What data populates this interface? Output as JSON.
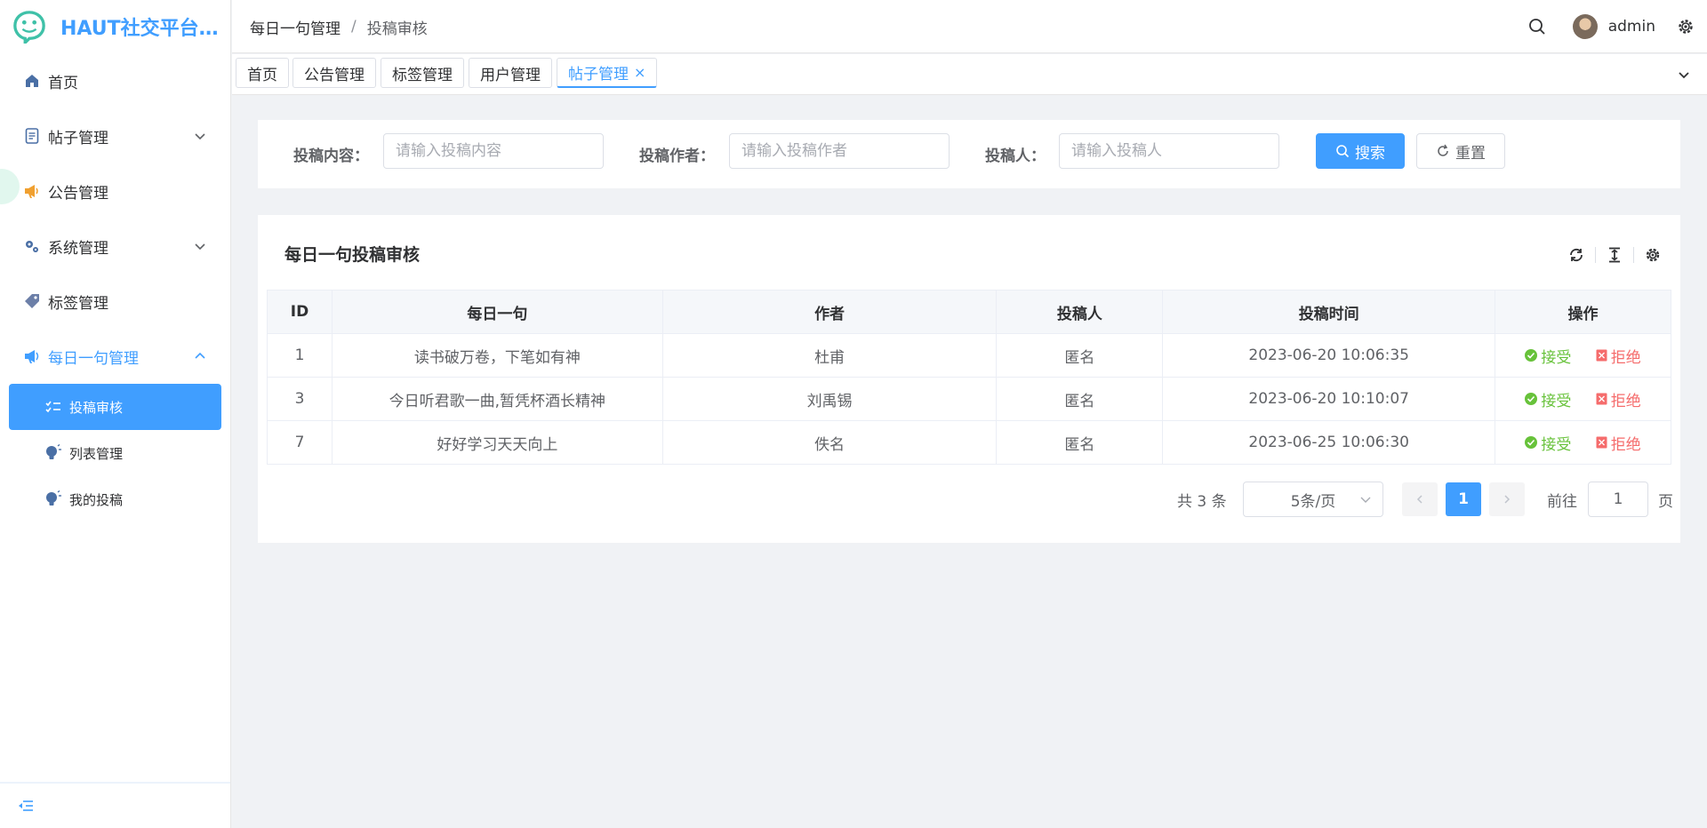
{
  "app": {
    "title": "HAUT社交平台管理系统"
  },
  "sidebar": {
    "items": [
      {
        "label": "首页",
        "icon": "home-icon"
      },
      {
        "label": "帖子管理",
        "icon": "document-icon"
      },
      {
        "label": "公告管理",
        "icon": "megaphone-icon"
      },
      {
        "label": "系统管理",
        "icon": "gears-icon"
      },
      {
        "label": "标签管理",
        "icon": "tag-icon"
      },
      {
        "label": "每日一句管理",
        "icon": "megaphone-icon"
      }
    ],
    "sub_items": [
      {
        "label": "投稿审核",
        "icon": "checklist-icon"
      },
      {
        "label": "列表管理",
        "icon": "bulb-icon"
      },
      {
        "label": "我的投稿",
        "icon": "bulb-icon"
      }
    ]
  },
  "header": {
    "breadcrumb": [
      "每日一句管理",
      "投稿审核"
    ],
    "breadcrumb_sep": "/",
    "username": "admin"
  },
  "tags": [
    {
      "label": "首页"
    },
    {
      "label": "公告管理"
    },
    {
      "label": "标签管理"
    },
    {
      "label": "用户管理"
    },
    {
      "label": "帖子管理",
      "active": true,
      "close": "×"
    }
  ],
  "search": {
    "content_label": "投稿内容：",
    "content_placeholder": "请输入投稿内容",
    "author_label": "投稿作者：",
    "author_placeholder": "请输入投稿作者",
    "submitter_label": "投稿人：",
    "submitter_placeholder": "请输入投稿人",
    "search_btn": "搜索",
    "reset_btn": "重置"
  },
  "table": {
    "title": "每日一句投稿审核",
    "columns": [
      "ID",
      "每日一句",
      "作者",
      "投稿人",
      "投稿时间",
      "操作"
    ],
    "rows": [
      {
        "id": "1",
        "sentence": "读书破万卷，下笔如有神",
        "author": "杜甫",
        "submitter": "匿名",
        "time": "2023-06-20 10:06:35"
      },
      {
        "id": "3",
        "sentence": "今日听君歌一曲,暂凭杯酒长精神",
        "author": "刘禹锡",
        "submitter": "匿名",
        "time": "2023-06-20 10:10:07"
      },
      {
        "id": "7",
        "sentence": "好好学习天天向上",
        "author": "佚名",
        "submitter": "匿名",
        "time": "2023-06-25 10:06:30"
      }
    ],
    "accept_label": "接受",
    "reject_label": "拒绝"
  },
  "pagination": {
    "total_text": "共 3 条",
    "page_size": "5条/页",
    "current_page": "1",
    "goto_label": "前往",
    "goto_value": "1",
    "page_suffix": "页"
  },
  "colors": {
    "primary": "#409eff",
    "success": "#67c23a",
    "danger": "#f56c6c"
  }
}
